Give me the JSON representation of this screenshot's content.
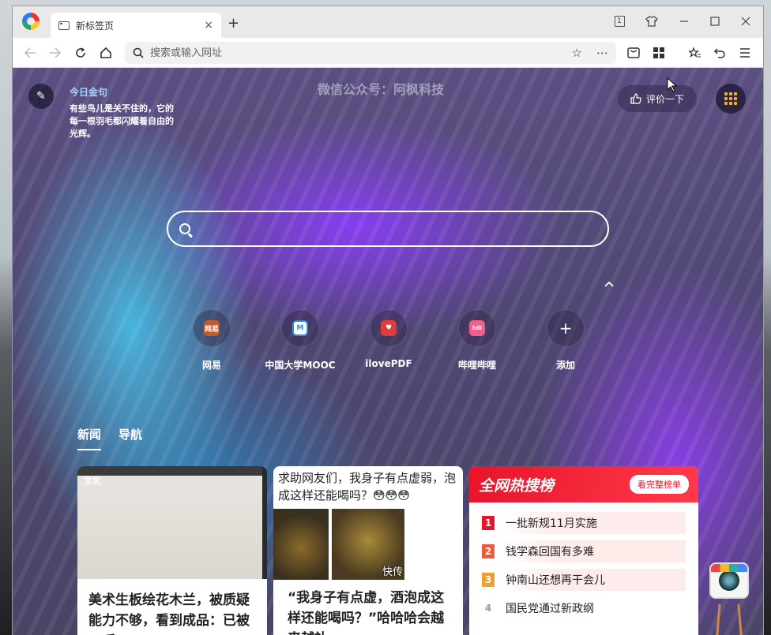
{
  "browser": {
    "tab_title": "新标签页",
    "new_tab_symbol": "+",
    "close_symbol": "×",
    "tab_count": "1",
    "address_placeholder": "搜索或输入网址"
  },
  "quote": {
    "title": "今日金句",
    "text": "有些鸟儿是关不住的，它的每一根羽毛都闪耀着自由的光辉。"
  },
  "watermark": "微信公众号：阿枫科技",
  "rate_label": "评价一下",
  "shortcuts": [
    {
      "label": "网易",
      "color": "#c25a2b",
      "glyph": "网易"
    },
    {
      "label": "中国大学MOOC",
      "color": "#2b8fd6",
      "glyph": "M"
    },
    {
      "label": "ilovePDF",
      "color": "#e23b3b",
      "glyph": "♥"
    },
    {
      "label": "哔哩哔哩",
      "color": "#f25d8e",
      "glyph": "bili"
    },
    {
      "label": "添加",
      "color": "transparent",
      "glyph": "+"
    }
  ],
  "news_tabs": [
    "新闻",
    "导航"
  ],
  "cards": {
    "card1": {
      "tag": "文化",
      "title": "美术生板绘花木兰，被质疑能力不够，看到成品：已被二呼"
    },
    "card2": {
      "top": "求助网友们，我身子有点虚弱，泡成这样还能喝吗？😳😳😳",
      "overlay": "快传",
      "title": "“我身子有点虚，酒泡成这样还能喝吗？”哈哈哈会越来越补"
    }
  },
  "hot": {
    "title": "全网热搜榜",
    "more": "看完整榜单",
    "items": [
      {
        "rank": "1",
        "text": "一批新规11月实施",
        "color": "#e8142a"
      },
      {
        "rank": "2",
        "text": "钱学森回国有多难",
        "color": "#f05a3a"
      },
      {
        "rank": "3",
        "text": "钟南山还想再干会儿",
        "color": "#f0a030"
      },
      {
        "rank": "4",
        "text": "国民党通过新政纲",
        "color": "#ffffff"
      }
    ]
  }
}
